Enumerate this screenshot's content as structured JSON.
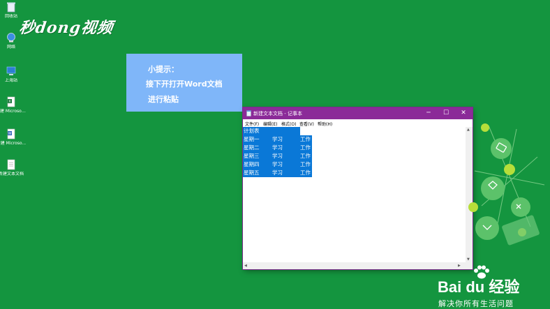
{
  "desktop": {
    "icons": [
      {
        "label": "回收站",
        "icon": "recycle-bin-icon"
      },
      {
        "label": "网络",
        "icon": "network-icon"
      },
      {
        "label": "上海站",
        "icon": "shortcut-icon"
      },
      {
        "label": "新建 Microsoft...",
        "icon": "excel-file-icon"
      },
      {
        "label": "新建 Microso...",
        "icon": "word-file-icon"
      },
      {
        "label": "新建文本文档",
        "icon": "text-file-icon"
      }
    ]
  },
  "watermark": "秒dong视频",
  "tip": {
    "line1": "小提示：",
    "line2": "接下开打开Word文档",
    "line3": "进行粘贴"
  },
  "notepad": {
    "title": "新建文本文档 - 记事本",
    "controls": {
      "minimize": "─",
      "maximize": "☐",
      "close": "✕"
    },
    "menu": [
      "文件(F)",
      "编辑(E)",
      "格式(O)",
      "查看(V)",
      "帮助(H)"
    ],
    "content": {
      "heading": "计划表",
      "rows": [
        {
          "day": "星期一",
          "a": "学习",
          "b": "工作"
        },
        {
          "day": "星期二",
          "a": "学习",
          "b": "工作"
        },
        {
          "day": "星期三",
          "a": "学习",
          "b": "工作"
        },
        {
          "day": "星期四",
          "a": "学习",
          "b": "工作"
        },
        {
          "day": "星期五",
          "a": "学习",
          "b": "工作"
        }
      ]
    }
  },
  "baidu": {
    "brand": "Bai du 经验",
    "slogan": "解决你所有生活问题"
  },
  "colors": {
    "desktop_bg": "#14953f",
    "tip_bg": "#7fb6f9",
    "titlebar": "#8b2a98",
    "selection": "#0a78d7"
  }
}
